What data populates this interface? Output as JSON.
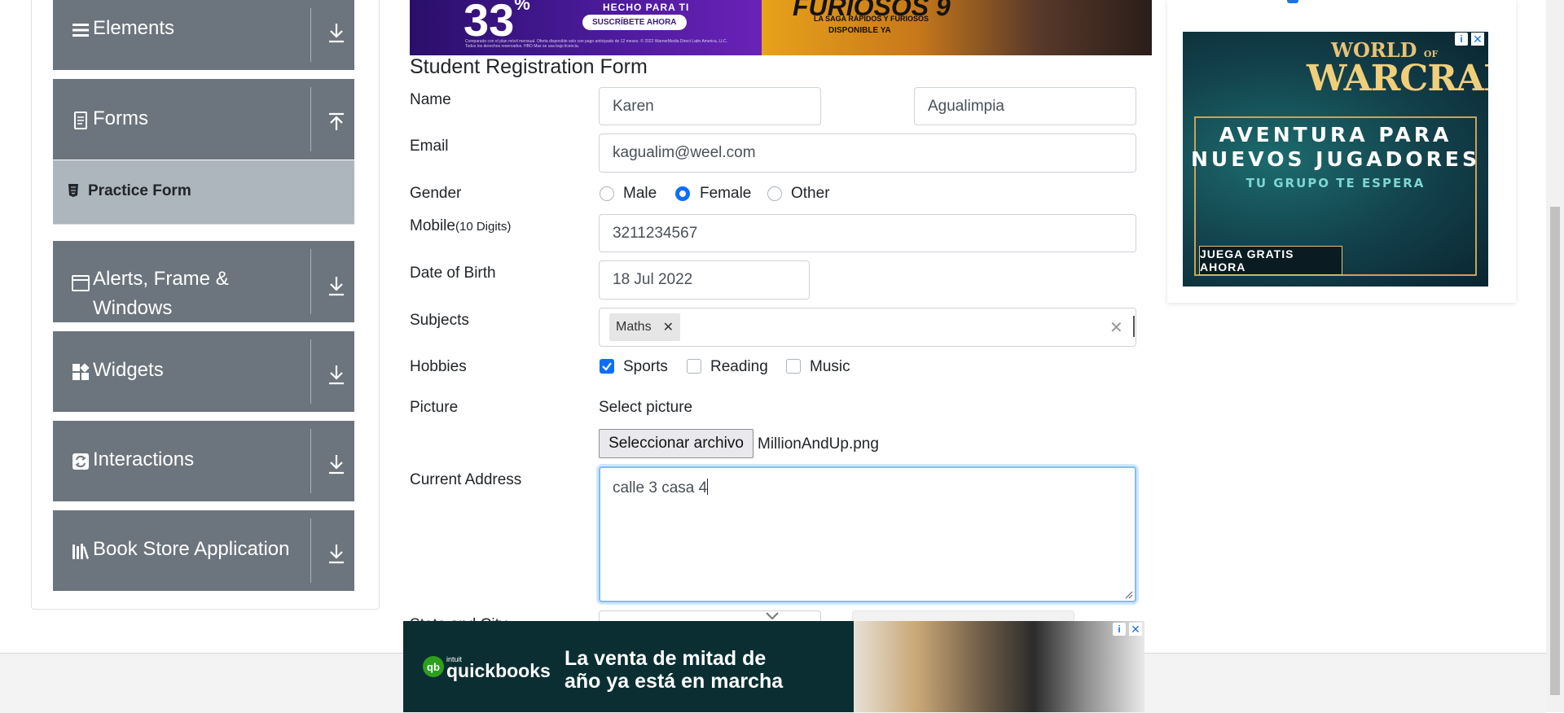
{
  "sidebar": {
    "groups": [
      {
        "title": "Elements",
        "icon": "list-icon",
        "arrow": "download-arrow-icon"
      },
      {
        "title": "Forms",
        "icon": "document-icon",
        "arrow": "upload-arrow-icon"
      },
      {
        "title": "Alerts, Frame & Windows",
        "icon": "window-icon",
        "arrow": "download-arrow-icon"
      },
      {
        "title": "Widgets",
        "icon": "widgets-icon",
        "arrow": "download-arrow-icon"
      },
      {
        "title": "Interactions",
        "icon": "interactions-icon",
        "arrow": "download-arrow-icon"
      },
      {
        "title": "Book Store Application",
        "icon": "books-icon",
        "arrow": "download-arrow-icon"
      }
    ],
    "active_item": "Practice Form"
  },
  "top_ad": {
    "left": {
      "percent": "33",
      "percent_suffix": "%",
      "tagline": "HECHO PARA TI",
      "cta": "SUSCRÍBETE AHORA",
      "legal": "Comparado con el plan móvil mensual. Oferta disponible solo con pago anticipado de 12 meses. © 2022 WarnerMedia Direct Latin America, LLC. Todos los derechos reservados. HBO Max se usa bajo licencia."
    },
    "right": {
      "title": "FURIOSOS 9",
      "subtitle": "LA SAGA RÁPIDOS Y FURIOSOS",
      "availability": "DISPONIBLE YA"
    }
  },
  "form": {
    "title": "Student Registration Form",
    "labels": {
      "name": "Name",
      "email": "Email",
      "gender": "Gender",
      "mobile": "Mobile",
      "mobile_hint": "(10 Digits)",
      "dob": "Date of Birth",
      "subjects": "Subjects",
      "hobbies": "Hobbies",
      "picture": "Picture",
      "current_address": "Current Address",
      "state_city": "State and City"
    },
    "first_name": "Karen",
    "last_name": "Agualimpia",
    "email": "kagualim@weel.com",
    "gender_options": [
      "Male",
      "Female",
      "Other"
    ],
    "gender_selected": "Female",
    "mobile": "3211234567",
    "dob": "18 Jul 2022",
    "subjects": [
      "Maths"
    ],
    "hobbies": [
      {
        "label": "Sports",
        "checked": true
      },
      {
        "label": "Reading",
        "checked": false
      },
      {
        "label": "Music",
        "checked": false
      }
    ],
    "picture_prompt": "Select picture",
    "file_button": "Seleccionar archivo",
    "file_name": "MillionAndUp.png",
    "current_address": "calle 3 casa 4"
  },
  "right_ad": {
    "brand_top": "WORLD",
    "brand_of": "OF",
    "brand_main": "WARCRAFT",
    "line1": "AVENTURA PARA",
    "line2": "NUEVOS JUGADORES",
    "line3": "TU GRUPO TE ESPERA",
    "cta": "JUEGA GRATIS AHORA"
  },
  "bottom_ad": {
    "brand_prefix": "intuit",
    "brand": "quickbooks",
    "headline_line1": "La venta de mitad de",
    "headline_line2": "año ya está en marcha"
  },
  "colors": {
    "sidebar_group": "#6c757d",
    "sidebar_active": "#adb5bd",
    "accent": "#0d6efd",
    "focus_border": "#80bdff"
  }
}
